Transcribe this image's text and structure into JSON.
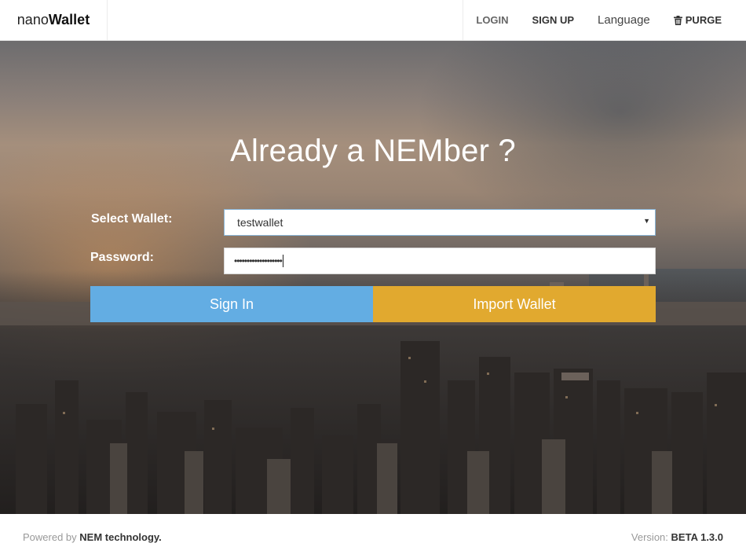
{
  "navbar": {
    "brand_light": "nano",
    "brand_bold": "Wallet",
    "items": {
      "login": "LOGIN",
      "signup": "SIGN UP",
      "language": "Language",
      "purge": "PURGE"
    }
  },
  "hero": {
    "title": "Already a NEMber ?",
    "select_wallet_label": "Select Wallet:",
    "selected_wallet": "testwallet",
    "password_label": "Password:",
    "password_masked": "•••••••••••••••••••",
    "sign_in_label": "Sign In",
    "import_wallet_label": "Import Wallet"
  },
  "footer": {
    "powered_by": "Powered by",
    "technology": "NEM technology.",
    "version_label": "Version:",
    "version_value": "BETA 1.3.0"
  },
  "colors": {
    "sign_in": "#63ade3",
    "import_wallet": "#e1a92f"
  }
}
